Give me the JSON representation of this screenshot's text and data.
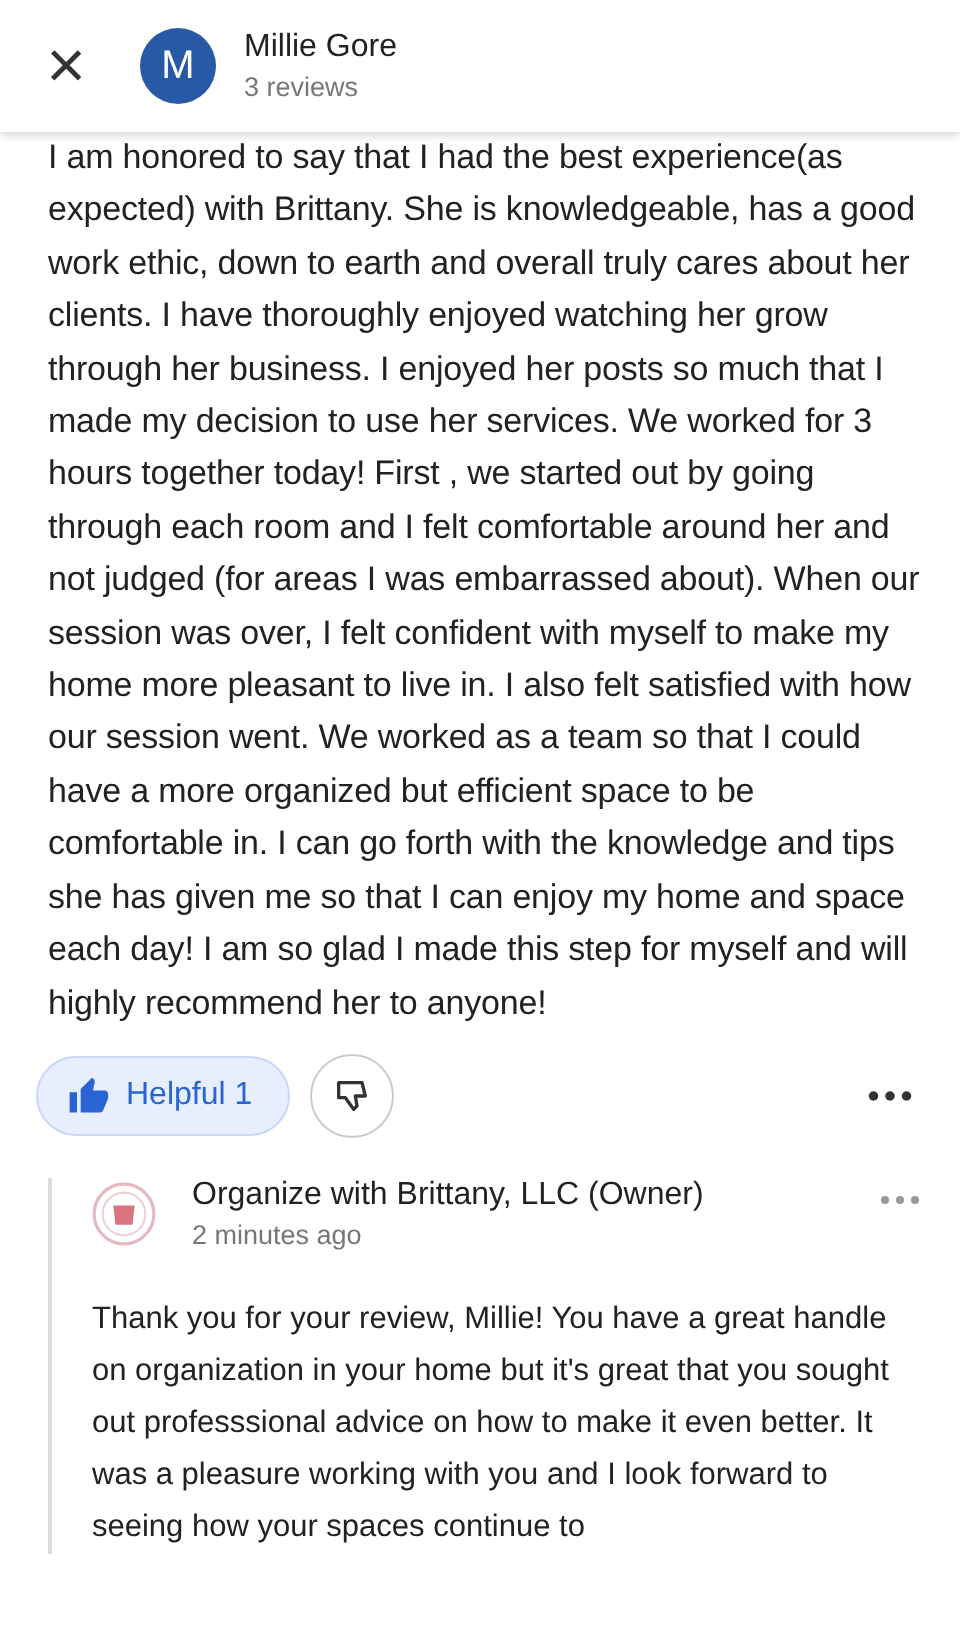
{
  "header": {
    "close": "×",
    "avatar_letter": "M",
    "name": "Millie Gore",
    "subtitle": "3 reviews"
  },
  "review": {
    "text": "I am honored to say that I had the best experience(as expected) with Brittany. She is knowledgeable, has a good work ethic, down to earth and overall truly cares about her clients. I have thoroughly enjoyed watching her grow through her business. I enjoyed her posts so much that I made my decision to use her services. We worked for 3 hours together today! First , we started out by going through each room and I felt comfortable around her and not judged (for areas I was embarrassed about). When our session was over, I felt confident with myself to make my home more pleasant to live in. I also felt satisfied with how our session went. We worked as a team so that I could have a more organized but efficient space to be comfortable in. I can go forth with the knowledge and tips she has given me so that I can enjoy my home and space each day! I am so glad I made this step for myself and will highly recommend her to anyone!",
    "helpful": {
      "label": "Helpful 1",
      "selected": true
    },
    "not_helpful": {
      "selected": false
    }
  },
  "reply": {
    "author": "Organize with Brittany, LLC (Owner)",
    "time": "2 minutes ago",
    "text": "Thank you for your review, Millie! You have a great handle on organization in your home but it's great that you sought out professsional advice on how to make it even better. It was a pleasure working with you and I look forward to seeing how your spaces continue to"
  }
}
